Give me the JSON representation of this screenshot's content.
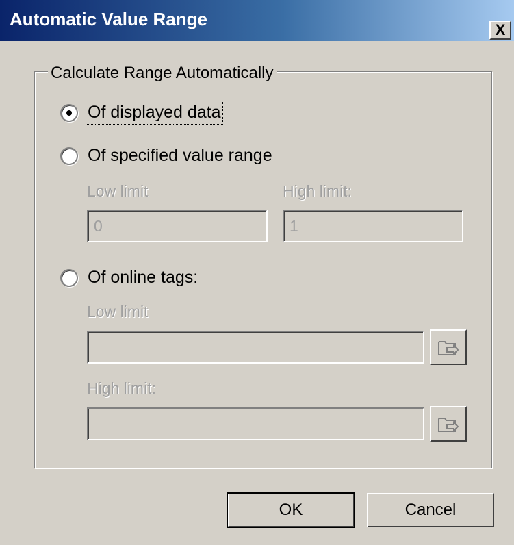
{
  "window": {
    "title": "Automatic Value Range",
    "close_label": "X"
  },
  "group": {
    "label": "Calculate Range Automatically"
  },
  "options": [
    {
      "label": "Of displayed data",
      "checked": true
    },
    {
      "label": "Of specified value range",
      "checked": false
    },
    {
      "label": "Of online tags:",
      "checked": false
    }
  ],
  "value_range": {
    "low_label": "Low limit",
    "low_value": "0",
    "high_label": "High limit:",
    "high_value": "1"
  },
  "online_tags": {
    "low_label": "Low limit",
    "low_value": "",
    "high_label": "High limit:",
    "high_value": ""
  },
  "buttons": {
    "ok": "OK",
    "cancel": "Cancel"
  },
  "colors": {
    "dialog_bg": "#d4d0c8",
    "title_dark": "#0a246a",
    "title_light": "#a6caf0",
    "disabled_text": "#a0a0a0"
  }
}
